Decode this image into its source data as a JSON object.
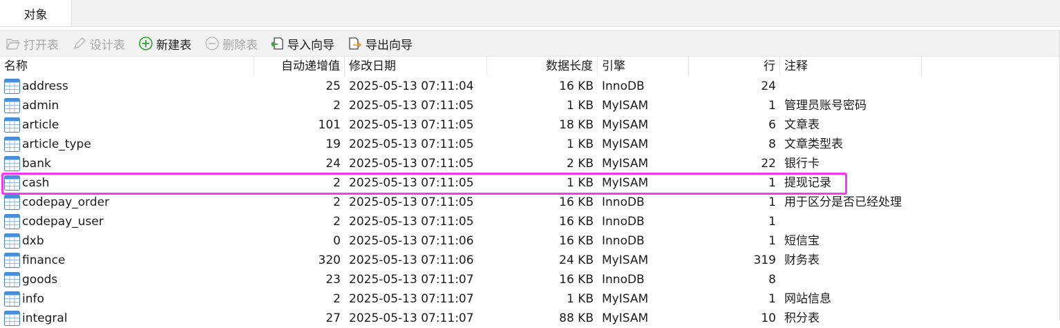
{
  "tabs": [
    {
      "label": "对象"
    }
  ],
  "toolbar": {
    "open_table": "打开表",
    "design_table": "设计表",
    "new_table": "新建表",
    "delete_table": "删除表",
    "import_wizard": "导入向导",
    "export_wizard": "导出向导"
  },
  "columns": {
    "name": "名称",
    "auto_increment": "自动递增值",
    "modified": "修改日期",
    "data_length": "数据长度",
    "engine": "引擎",
    "rows": "行",
    "comment": "注释"
  },
  "rows": [
    {
      "name": "address",
      "auto_inc": "25",
      "modified": "2025-05-13 07:11:04",
      "length": "16 KB",
      "engine": "InnoDB",
      "rows": "24",
      "comment": ""
    },
    {
      "name": "admin",
      "auto_inc": "2",
      "modified": "2025-05-13 07:11:05",
      "length": "1 KB",
      "engine": "MyISAM",
      "rows": "1",
      "comment": "管理员账号密码"
    },
    {
      "name": "article",
      "auto_inc": "101",
      "modified": "2025-05-13 07:11:05",
      "length": "18 KB",
      "engine": "MyISAM",
      "rows": "6",
      "comment": "文章表"
    },
    {
      "name": "article_type",
      "auto_inc": "19",
      "modified": "2025-05-13 07:11:05",
      "length": "1 KB",
      "engine": "MyISAM",
      "rows": "8",
      "comment": "文章类型表"
    },
    {
      "name": "bank",
      "auto_inc": "24",
      "modified": "2025-05-13 07:11:05",
      "length": "2 KB",
      "engine": "MyISAM",
      "rows": "22",
      "comment": "银行卡"
    },
    {
      "name": "cash",
      "auto_inc": "2",
      "modified": "2025-05-13 07:11:05",
      "length": "1 KB",
      "engine": "MyISAM",
      "rows": "1",
      "comment": "提现记录"
    },
    {
      "name": "codepay_order",
      "auto_inc": "2",
      "modified": "2025-05-13 07:11:05",
      "length": "16 KB",
      "engine": "InnoDB",
      "rows": "1",
      "comment": "用于区分是否已经处理"
    },
    {
      "name": "codepay_user",
      "auto_inc": "2",
      "modified": "2025-05-13 07:11:05",
      "length": "16 KB",
      "engine": "InnoDB",
      "rows": "1",
      "comment": ""
    },
    {
      "name": "dxb",
      "auto_inc": "0",
      "modified": "2025-05-13 07:11:06",
      "length": "16 KB",
      "engine": "InnoDB",
      "rows": "1",
      "comment": "短信宝"
    },
    {
      "name": "finance",
      "auto_inc": "320",
      "modified": "2025-05-13 07:11:06",
      "length": "24 KB",
      "engine": "MyISAM",
      "rows": "319",
      "comment": "财务表"
    },
    {
      "name": "goods",
      "auto_inc": "23",
      "modified": "2025-05-13 07:11:07",
      "length": "16 KB",
      "engine": "InnoDB",
      "rows": "8",
      "comment": ""
    },
    {
      "name": "info",
      "auto_inc": "2",
      "modified": "2025-05-13 07:11:07",
      "length": "1 KB",
      "engine": "MyISAM",
      "rows": "1",
      "comment": "网站信息"
    },
    {
      "name": "integral",
      "auto_inc": "27",
      "modified": "2025-05-13 07:11:07",
      "length": "88 KB",
      "engine": "MyISAM",
      "rows": "10",
      "comment": "积分表"
    }
  ],
  "highlighted_table": "cash",
  "colors": {
    "highlight": "#ff33ff",
    "accent_green": "#2aa52a",
    "accent_orange": "#e8a02a",
    "table_icon": "#4a90d9"
  }
}
